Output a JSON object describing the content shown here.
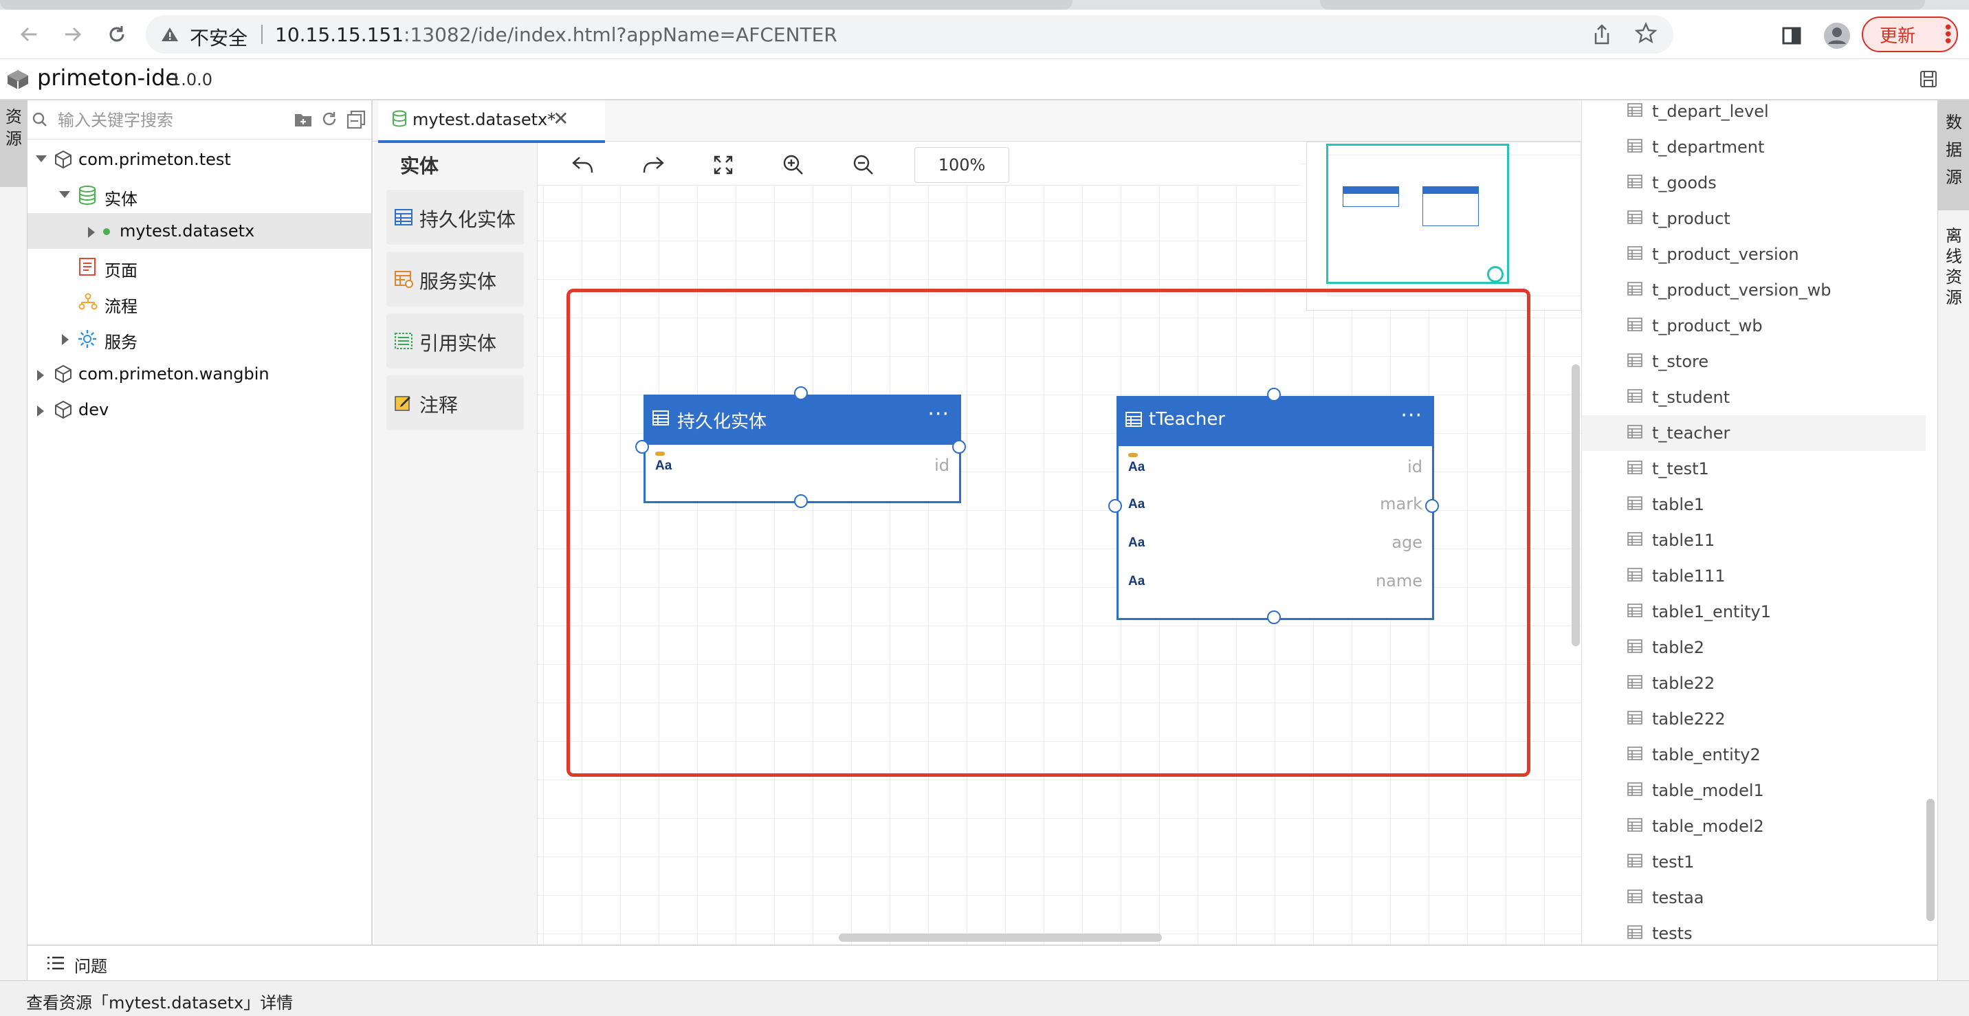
{
  "browser": {
    "insecure_label": "不安全",
    "url_host": "10.15.15.151",
    "url_rest": ":13082/ide/index.html?appName=AFCENTER",
    "update_label": "更新"
  },
  "app": {
    "title": "primeton-ide",
    "version": "1.0.0"
  },
  "left_vtab": "资源",
  "explorer": {
    "search_placeholder": "输入关键字搜索",
    "tree": {
      "pkg1": "com.primeton.test",
      "entity_folder": "实体",
      "datasetx_file": "mytest.datasetx",
      "page": "页面",
      "flow": "流程",
      "service": "服务",
      "pkg2": "com.primeton.wangbin",
      "pkg3": "dev"
    }
  },
  "editor": {
    "tab_label": "mytest.datasetx*",
    "palette": {
      "title": "实体",
      "items": [
        "持久化实体",
        "服务实体",
        "引用实体",
        "注释"
      ]
    },
    "zoom": "100%",
    "entities": [
      {
        "name": "持久化实体",
        "fields": [
          "id"
        ]
      },
      {
        "name": "tTeacher",
        "fields": [
          "id",
          "mark",
          "age",
          "name"
        ]
      }
    ]
  },
  "datasource": {
    "tables": [
      "t_depart_level",
      "t_department",
      "t_goods",
      "t_product",
      "t_product_version",
      "t_product_version_wb",
      "t_product_wb",
      "t_store",
      "t_student",
      "t_teacher",
      "t_test1",
      "table1",
      "table11",
      "table111",
      "table1_entity1",
      "table2",
      "table22",
      "table222",
      "table_entity2",
      "table_model1",
      "table_model2",
      "test1",
      "testaa",
      "tests"
    ],
    "selected": "t_teacher"
  },
  "right_vtabs": [
    "数据源",
    "离线资源"
  ],
  "problems_label": "问题",
  "status_text": "查看资源「mytest.datasetx」详情",
  "colors": {
    "accent": "#2f6fc9",
    "highlight": "#e03a2c",
    "minimap": "#27c4b4"
  }
}
